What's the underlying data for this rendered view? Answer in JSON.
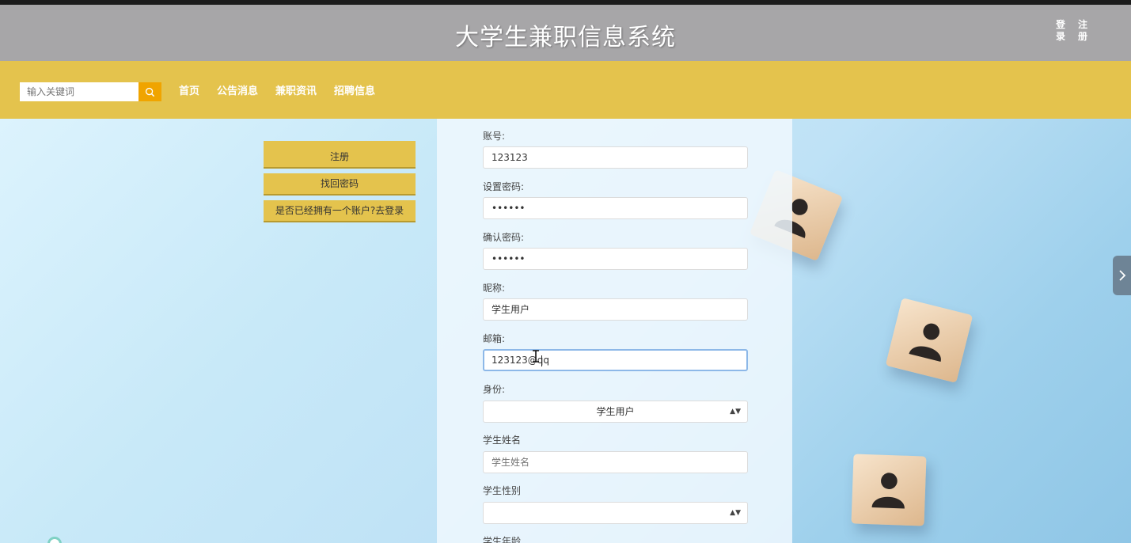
{
  "header": {
    "title": "大学生兼职信息系统",
    "login_label": "登录",
    "register_label": "注册"
  },
  "navbar": {
    "search_placeholder": "输入关键词",
    "items": [
      "首页",
      "公告消息",
      "兼职资讯",
      "招聘信息"
    ]
  },
  "side_buttons": {
    "register": "注册",
    "recover_password": "找回密码",
    "login_prompt": "是否已经拥有一个账户?去登录"
  },
  "form": {
    "account_label": "账号:",
    "account_value": "123123",
    "password_label": "设置密码:",
    "password_value": "••••••",
    "confirm_label": "确认密码:",
    "confirm_value": "••••••",
    "nickname_label": "昵称:",
    "nickname_value": "学生用户",
    "email_label": "邮箱:",
    "email_value": "123123@qq",
    "role_label": "身份:",
    "role_value": "学生用户",
    "student_name_label": "学生姓名",
    "student_name_placeholder": "学生姓名",
    "gender_label": "学生性别",
    "gender_value": "",
    "age_label": "学生年龄"
  },
  "colors": {
    "header_bg": "#a7a6a8",
    "navbar_bg": "#e4c34d",
    "search_button": "#f0a400",
    "side_tab": "#6e8496"
  },
  "icons": {
    "search": "search-icon",
    "select_arrow": "updown-arrow-icon",
    "side_tab": "chevron-right-icon",
    "cursor": "text-cursor-icon"
  }
}
